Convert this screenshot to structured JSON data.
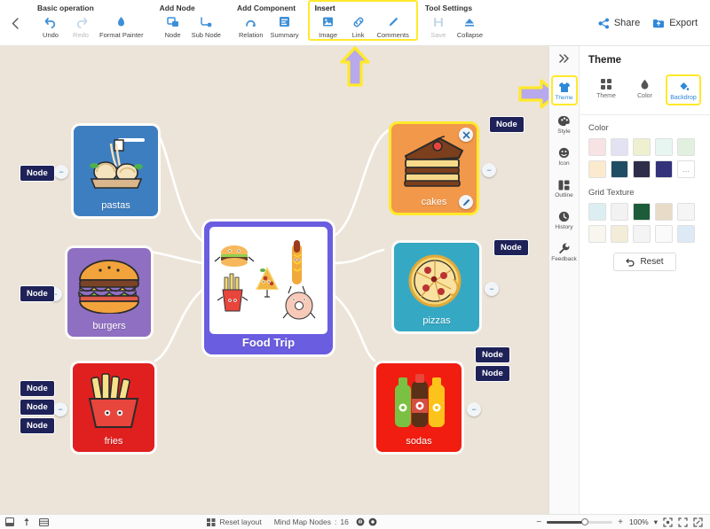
{
  "toolbar": {
    "back_icon": "chevron-left-icon",
    "groups": [
      {
        "title": "Basic operation",
        "items": [
          {
            "label": "Undo",
            "icon": "undo-arrow-icon",
            "disabled": false
          },
          {
            "label": "Redo",
            "icon": "redo-arrow-icon",
            "disabled": true
          },
          {
            "label": "Format Painter",
            "icon": "format-painter-icon",
            "disabled": false
          }
        ]
      },
      {
        "title": "Add Node",
        "items": [
          {
            "label": "Node",
            "icon": "node-icon",
            "disabled": false
          },
          {
            "label": "Sub Node",
            "icon": "sub-node-icon",
            "disabled": false
          }
        ]
      },
      {
        "title": "Add Component",
        "items": [
          {
            "label": "Relation",
            "icon": "relation-arrow-icon",
            "disabled": false
          },
          {
            "label": "Summary",
            "icon": "summary-icon",
            "disabled": false
          }
        ]
      },
      {
        "title": "Insert",
        "highlighted": true,
        "items": [
          {
            "label": "Image",
            "icon": "image-icon",
            "disabled": false
          },
          {
            "label": "Link",
            "icon": "link-icon",
            "disabled": false
          },
          {
            "label": "Comments",
            "icon": "comments-pen-icon",
            "disabled": false
          }
        ]
      },
      {
        "title": "Tool Settings",
        "items": [
          {
            "label": "Save",
            "icon": "save-disk-icon",
            "disabled": true
          },
          {
            "label": "Collapse",
            "icon": "collapse-icon",
            "disabled": false
          }
        ]
      }
    ],
    "share_label": "Share",
    "export_label": "Export"
  },
  "canvas": {
    "background_color": "#ece4d8",
    "center_node": {
      "label": "Food Trip",
      "color": "#6a5de0"
    },
    "nodes": [
      {
        "label": "pastas",
        "color": "#3d7ec0",
        "selected": false
      },
      {
        "label": "burgers",
        "color": "#8f6fc2",
        "selected": false
      },
      {
        "label": "fries",
        "color": "#e01f1f",
        "selected": false
      },
      {
        "label": "cakes",
        "color": "#f2984a",
        "selected": true
      },
      {
        "label": "pizzas",
        "color": "#35a8c4",
        "selected": false
      },
      {
        "label": "sodas",
        "color": "#f01d10",
        "selected": false
      }
    ],
    "badges": [
      {
        "label": "Node"
      },
      {
        "label": "Node"
      },
      {
        "label": "Node"
      },
      {
        "label": "Node"
      },
      {
        "label": "Node"
      },
      {
        "label": "Node"
      },
      {
        "label": "Node"
      },
      {
        "label": "Node"
      }
    ],
    "selected_node_controls": {
      "close_icon": "close-x-icon",
      "edit_icon": "edit-pencil-icon"
    },
    "annotations": [
      {
        "name": "arrow-up-to-image-tool",
        "direction": "up",
        "fill": "#b8a8ec",
        "outline": "#ffe92b"
      },
      {
        "name": "arrow-right-to-theme-tab",
        "direction": "right",
        "fill": "#b8a8ec",
        "outline": "#ffe92b"
      }
    ]
  },
  "rail": {
    "collapse_icon": "chevron-double-right-icon",
    "items": [
      {
        "label": "Theme",
        "icon": "tshirt-icon",
        "active": true
      },
      {
        "label": "Style",
        "icon": "palette-icon",
        "active": false
      },
      {
        "label": "Icon",
        "icon": "smiley-icon",
        "active": false
      },
      {
        "label": "Outline",
        "icon": "outline-icon",
        "active": false
      },
      {
        "label": "History",
        "icon": "clock-icon",
        "active": false
      },
      {
        "label": "Feedback",
        "icon": "wrench-icon",
        "active": false
      }
    ]
  },
  "panel": {
    "title": "Theme",
    "tabs": [
      {
        "label": "Theme",
        "icon": "grid-squares-icon",
        "active": false
      },
      {
        "label": "Color",
        "icon": "droplet-icon",
        "active": false
      },
      {
        "label": "Backdrop",
        "icon": "paint-fill-icon",
        "active": true
      }
    ],
    "color_section": {
      "label": "Color",
      "swatches": [
        "#f7e3e3",
        "#e2e2f2",
        "#eff0cf",
        "#e7f6f1",
        "#e2f0df",
        "#fbeacd",
        "#1f4d63",
        "#2e2d4a",
        "#33327a"
      ],
      "more_label": "..."
    },
    "grid_section": {
      "label": "Grid Texture",
      "swatches": [
        "#dceef2",
        "#f2f2f2",
        "#1d5c38",
        "#e8dcc8",
        "#f5f5f5",
        "#f8f6ef",
        "#f3ecd9",
        "#f4f4f4",
        "#fafafa",
        "#dde9f5"
      ]
    },
    "reset_label": "Reset",
    "reset_icon": "undo-arrow-icon"
  },
  "statusbar": {
    "left_icons": [
      {
        "name": "layout-panel-icon"
      },
      {
        "name": "pin-icon"
      },
      {
        "name": "grid-view-icon"
      }
    ],
    "reset_layout_label": "Reset layout",
    "reset_layout_icon": "layout-grid-icon",
    "nodes_label": "Mind Map Nodes",
    "nodes_separator": ":",
    "nodes_count": "16",
    "center_icons": [
      {
        "name": "hand-tool-icon"
      },
      {
        "name": "eye-icon"
      }
    ],
    "zoom_minus": "−",
    "zoom_plus": "+",
    "zoom_value": "100%",
    "zoom_caret": "▾",
    "right_icons": [
      {
        "name": "fit-to-screen-icon"
      },
      {
        "name": "center-focus-icon"
      },
      {
        "name": "fullscreen-icon"
      }
    ]
  }
}
